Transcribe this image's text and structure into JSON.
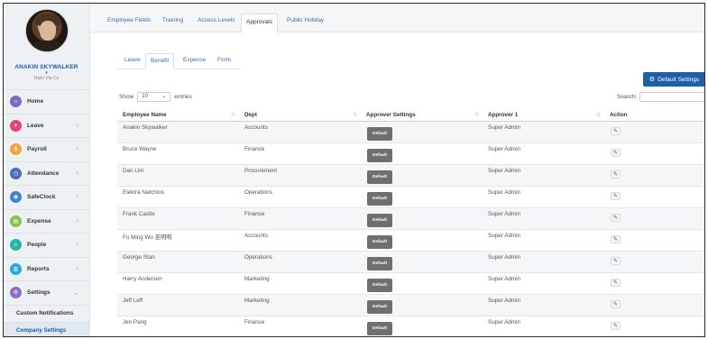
{
  "user": {
    "name": "ANAKIN SKYWALKER",
    "company": "Hailo Via Co"
  },
  "sidebar": {
    "items": [
      {
        "label": "Home",
        "icon": "home-icon",
        "color": "#7b6bc4",
        "glyph": "⌂",
        "arrow": false
      },
      {
        "label": "Leave",
        "icon": "leave-icon",
        "color": "#e2446f",
        "glyph": "✈",
        "arrow": true
      },
      {
        "label": "Payroll",
        "icon": "payroll-icon",
        "color": "#f0a33a",
        "glyph": "$",
        "arrow": true
      },
      {
        "label": "Attendance",
        "icon": "attendance-icon",
        "color": "#4a6fb5",
        "glyph": "◷",
        "arrow": true
      },
      {
        "label": "SafeClock",
        "icon": "safeclock-icon",
        "color": "#3f86c9",
        "glyph": "◉",
        "arrow": true
      },
      {
        "label": "Expense",
        "icon": "expense-icon",
        "color": "#8bc34a",
        "glyph": "▤",
        "arrow": true
      },
      {
        "label": "People",
        "icon": "people-icon",
        "color": "#26b5a4",
        "glyph": "☺",
        "arrow": true
      },
      {
        "label": "Reports",
        "icon": "reports-icon",
        "color": "#29a8e0",
        "glyph": "▥",
        "arrow": true
      },
      {
        "label": "Settings",
        "icon": "settings-icon",
        "color": "#8d6fc8",
        "glyph": "⚙",
        "arrow": true
      }
    ],
    "sub_items": [
      "Custom Notifications",
      "Company Settings"
    ]
  },
  "top_tabs": [
    "Employee Fields",
    "Training",
    "Access Levels",
    "Approvals",
    "Public Holiday"
  ],
  "active_top_tab": "Approvals",
  "sub_tabs": [
    "Leave",
    "Benefit",
    "Expense",
    "Form"
  ],
  "active_sub_tab": "Benefit",
  "default_settings_label": "Default Settings",
  "show_label": "Show",
  "entries_value": "10",
  "entries_label": "entries",
  "search_label": "Search:",
  "table": {
    "headers": [
      "Employee Name",
      "Dept",
      "Approver Settings",
      "Approver 1",
      "Action"
    ],
    "default_label": "Default",
    "rows": [
      {
        "name": "Anakin Skywalker",
        "dept": "Accounts",
        "approver1": "Super Admin"
      },
      {
        "name": "Bruce Wayne",
        "dept": "Finance",
        "approver1": "Super Admin"
      },
      {
        "name": "Dan Lim",
        "dept": "Procurement",
        "approver1": "Super Admin"
      },
      {
        "name": "Elektra Natchios",
        "dept": "Operations",
        "approver1": "Super Admin"
      },
      {
        "name": "Frank Castle",
        "dept": "Finance",
        "approver1": "Super Admin"
      },
      {
        "name": "Fu Ming Wu 巫明明",
        "dept": "Accounts",
        "approver1": "Super Admin"
      },
      {
        "name": "George Stan",
        "dept": "Operations",
        "approver1": "Super Admin"
      },
      {
        "name": "Harry Anderson",
        "dept": "Marketing",
        "approver1": "Super Admin"
      },
      {
        "name": "Jeff Leff",
        "dept": "Marketing",
        "approver1": "Super Admin"
      },
      {
        "name": "Jen Pang",
        "dept": "Finance",
        "approver1": "Super Admin"
      }
    ]
  }
}
